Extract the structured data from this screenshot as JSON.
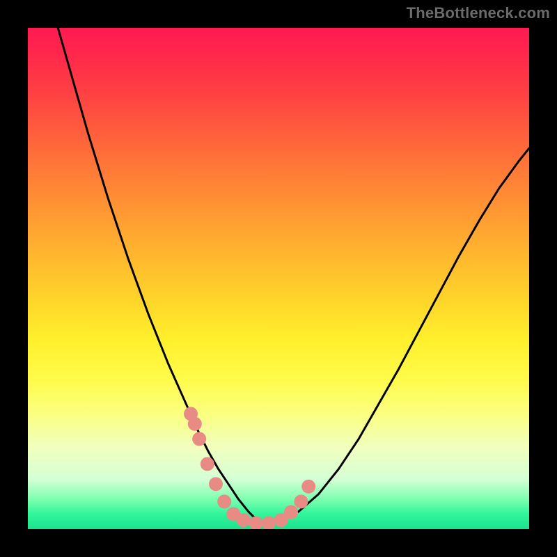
{
  "watermark": "TheBottleneck.com",
  "colors": {
    "frame": "#000000",
    "curve_stroke": "#000000",
    "point_fill": "#e88b85",
    "watermark": "#6b6b6b"
  },
  "chart_data": {
    "type": "line",
    "title": "",
    "xlabel": "",
    "ylabel": "",
    "xlim": [
      0,
      100
    ],
    "ylim": [
      0,
      100
    ],
    "grid": false,
    "legend": false,
    "series": [
      {
        "name": "bottleneck-curve",
        "x": [
          6,
          8,
          10,
          12,
          14,
          16,
          18,
          20,
          22,
          24,
          26,
          28,
          30,
          32,
          34,
          36,
          38,
          40,
          42,
          44,
          46,
          50,
          54,
          58,
          62,
          66,
          70,
          74,
          78,
          82,
          86,
          90,
          94,
          98,
          100
        ],
        "y": [
          100,
          93,
          86,
          79,
          72.5,
          66,
          60,
          54,
          48.5,
          43,
          38,
          33,
          28.5,
          24,
          19.5,
          15.5,
          12,
          9,
          6,
          3.5,
          1.5,
          1.5,
          3.5,
          7,
          12,
          18,
          25,
          32,
          39.5,
          47,
          54.5,
          61.5,
          68,
          73.5,
          76
        ]
      }
    ],
    "points": {
      "name": "highlighted-markers",
      "x": [
        32.5,
        33.3,
        34.2,
        35.8,
        37.5,
        39.2,
        41.0,
        43.0,
        45.5,
        48.0,
        50.5,
        52.5,
        54.5,
        56.0
      ],
      "y": [
        23,
        21,
        18,
        13,
        9,
        5.5,
        3,
        1.8,
        1.2,
        1.2,
        1.8,
        3.4,
        5.5,
        8.5
      ]
    }
  }
}
